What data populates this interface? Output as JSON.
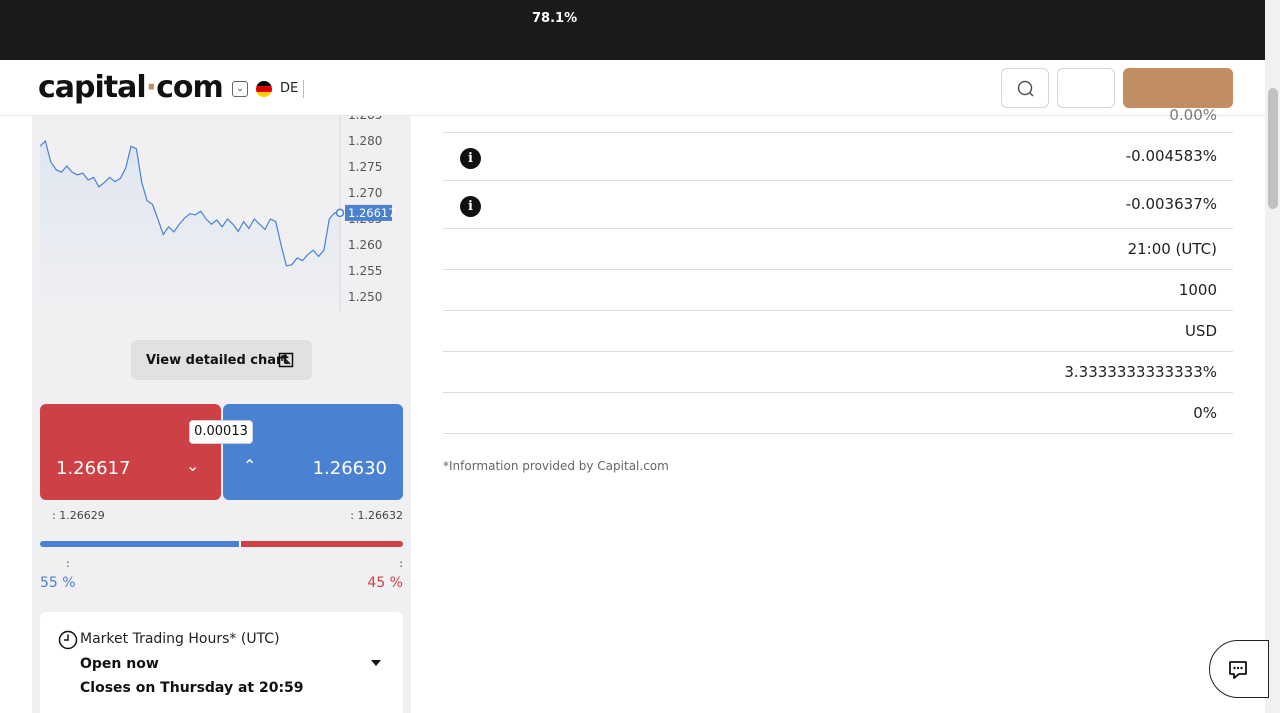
{
  "top_banner": {
    "percent": "78.1%"
  },
  "header": {
    "logo_text": "capital",
    "logo_dot": "·",
    "logo_suffix": "com",
    "language_code": "DE",
    "icons": [
      "search-icon",
      "chevron-down-icon",
      "germany-flag-icon"
    ]
  },
  "chart": {
    "y_ticks": [
      "1.280",
      "1.275",
      "1.270",
      "1.265",
      "1.260",
      "1.255",
      "1.250"
    ],
    "top_tick_partial": "1.285",
    "current_price": "1.26617",
    "view_button_label": "View detailed chart"
  },
  "chart_data": {
    "type": "area",
    "yticks": [
      1.28,
      1.275,
      1.27,
      1.265,
      1.26,
      1.255,
      1.25
    ],
    "current": 1.26617,
    "values": [
      1.279,
      1.28,
      1.276,
      1.2745,
      1.274,
      1.2752,
      1.274,
      1.2735,
      1.2738,
      1.2725,
      1.273,
      1.2712,
      1.272,
      1.273,
      1.2722,
      1.2728,
      1.2748,
      1.279,
      1.2785,
      1.272,
      1.2685,
      1.2678,
      1.265,
      1.262,
      1.2635,
      1.2625,
      1.264,
      1.2652,
      1.266,
      1.2658,
      1.2665,
      1.265,
      1.264,
      1.2648,
      1.2635,
      1.265,
      1.264,
      1.2626,
      1.2645,
      1.2632,
      1.265,
      1.264,
      1.263,
      1.265,
      1.2645,
      1.26,
      1.256,
      1.2562,
      1.2575,
      1.257,
      1.2582,
      1.259,
      1.2578,
      1.259,
      1.265,
      1.2662,
      1.26617
    ],
    "fill_color": "#dfe6f1",
    "line_color": "#4a81d0"
  },
  "trade": {
    "sell_price": "1.26617",
    "buy_price": "1.26630",
    "spread": "0.00013",
    "low_label": ": 1.26629",
    "high_label": ": 1.26632",
    "sentiment_colon_left": ":",
    "sentiment_colon_right": ":",
    "buy_percent_text": "55 %",
    "sell_percent_text": "45 %",
    "buy_percent": 55,
    "sell_percent": 45,
    "colors": {
      "sell": "#cd4146",
      "buy": "#4a81d0"
    }
  },
  "market_hours": {
    "title": "Market Trading Hours* (UTC)",
    "status": "Open now",
    "closes": "Closes on Thursday at 20:59"
  },
  "details_table": {
    "rows": [
      {
        "value": "0.00%",
        "partial": true,
        "info": false
      },
      {
        "value": "-0.004583%",
        "info": true
      },
      {
        "value": "-0.003637%",
        "info": true
      },
      {
        "value": "21:00 (UTC)",
        "info": false
      },
      {
        "value": "1000",
        "info": false
      },
      {
        "value": "USD",
        "info": false
      },
      {
        "value": "3.3333333333333%",
        "info": false
      },
      {
        "value": "0%",
        "info": false
      }
    ],
    "footnote": "*Information provided by Capital.com"
  },
  "brand_accent": "#c08e62"
}
